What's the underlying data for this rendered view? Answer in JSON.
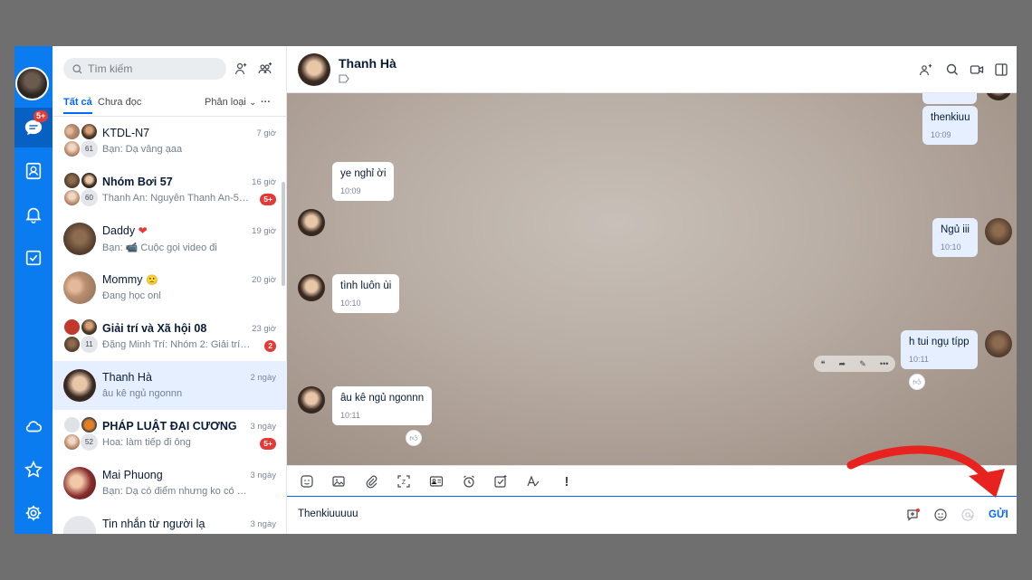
{
  "search": {
    "placeholder": "Tìm kiếm"
  },
  "rail": {
    "badge": "5+"
  },
  "tabs": {
    "all": "Tất cả",
    "unread": "Chưa đọc",
    "classify": "Phân loại",
    "more": "···"
  },
  "conversations": [
    {
      "name": "KTDL-N7",
      "preview": "Bạn: Dạ vâng ạaa",
      "time": "7 giờ",
      "member_count": "61",
      "bold": false
    },
    {
      "name": "Nhóm Bơi 57",
      "preview": "Thanh An: Nguyễn Thanh An-518...",
      "time": "16 giờ",
      "member_count": "60",
      "badge": "5+",
      "bold": true
    },
    {
      "name": "Daddy",
      "preview": "Bạn: 📹 Cuộc gọi video đi",
      "time": "19 giờ",
      "bold": false
    },
    {
      "name": "Mommy",
      "preview": "Đang học onl",
      "time": "20 giờ",
      "bold": false
    },
    {
      "name": "Giải trí và Xã hội 08",
      "preview": "Đặng Minh Trí: Nhóm 2: Giải trí sả...",
      "time": "23 giờ",
      "member_count": "11",
      "badge": "2",
      "bold": true
    },
    {
      "name": "Thanh Hà",
      "preview": "âu kê ngủ ngonnn",
      "time": "2 ngày",
      "bold": false,
      "selected": true
    },
    {
      "name": "PHÁP LUẬT ĐẠI CƯƠNG",
      "preview": "Hoa: làm tiếp đi ông",
      "time": "3 ngày",
      "member_count": "52",
      "badge": "5+",
      "bold": true
    },
    {
      "name": "Mai Phuong",
      "preview": "Bạn: Dạ có điểm nhưng ko có đáp...",
      "time": "3 ngày",
      "bold": false
    },
    {
      "name": "Tin nhắn từ người lạ",
      "preview": "",
      "time": "3 ngày",
      "bold": false
    }
  ],
  "chat": {
    "title": "Thanh Hà",
    "messages": [
      {
        "from": "me",
        "text": "thenkiuu",
        "time": "10:09"
      },
      {
        "from": "other",
        "text": "ye nghỉ ời",
        "time": "10:09"
      },
      {
        "from": "me",
        "text": "Ngủ iii",
        "time": "10:10"
      },
      {
        "from": "other",
        "text": "tình luôn ùi",
        "time": "10:10"
      },
      {
        "from": "me",
        "text": "h tui ngụ típp",
        "time": "10:11"
      },
      {
        "from": "other",
        "text": "âu kê ngủ ngonnn",
        "time": "10:11"
      }
    ]
  },
  "composer": {
    "text": "Thenkiuuuuu",
    "send_label": "GỬI"
  },
  "colors": {
    "accent": "#0068ff",
    "rail": "#0a7cf0",
    "badge": "#e53935",
    "arrow": "#e8231f"
  }
}
